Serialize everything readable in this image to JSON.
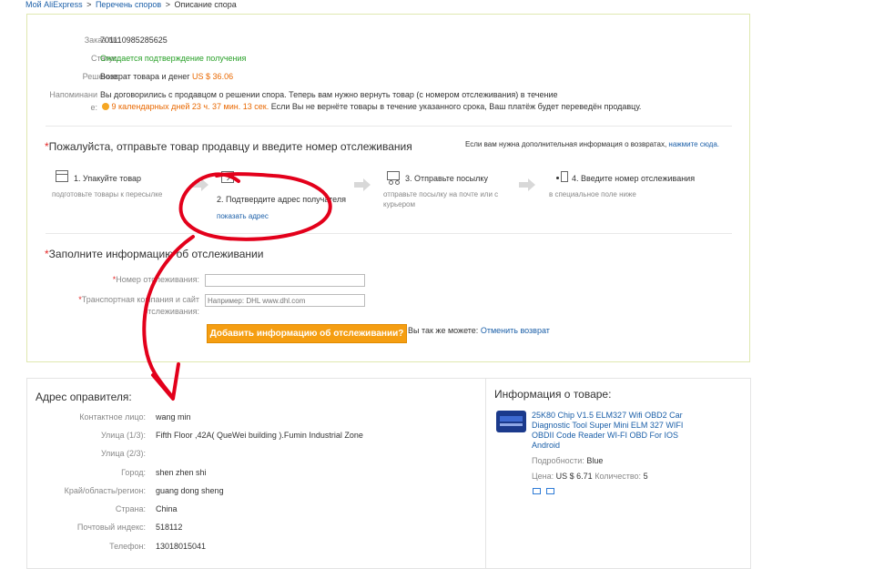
{
  "breadcrumb": {
    "home": "Мой AliExpress",
    "sep1": ">",
    "disputes": "Перечень споров",
    "sep2": ">",
    "current": "Описание спора"
  },
  "order": {
    "order_label": "Заказ №:",
    "order_no": "701110985285625",
    "status_label": "Статус:",
    "status": "Ожидается подтверждение получения",
    "decision_label": "Решение:",
    "decision": "Возврат товара и денег",
    "decision_amount": "US $ 36.06",
    "reminder_label_1": "Напоминани",
    "reminder_label_2": "е:",
    "reminder_line1": "Вы договорились с продавцом о решении спора. Теперь вам нужно вернуть товар (с номером отслеживания) в течение",
    "reminder_time": "9 календарных дней 23 ч. 37 мин. 13 сек.",
    "reminder_line2": "Если Вы не вернёте товары в течение указанного срока, Ваш платёж будет переведён продавцу."
  },
  "steps_section": {
    "title": "Пожалуйста, отправьте товар продавцу и введите номер отслеживания",
    "help_text": "Если вам нужна дополнительная информация о возвратах,",
    "help_link": "нажмите сюда.",
    "steps": [
      {
        "title": "1. Упакуйте товар",
        "desc": "подготовьте товары к пересылке"
      },
      {
        "title": "2. Подтвердите адрес получателя",
        "link": "показать адрес"
      },
      {
        "title": "3. Отправьте посылку",
        "desc": "отправьте посылку на почте или с курьером"
      },
      {
        "title": "4. Введите номер отслеживания",
        "desc": "в специальное поле ниже"
      }
    ]
  },
  "tracking_section": {
    "title": "Заполните информацию об отслеживании",
    "tracking_no_label": "Номер отслеживания:",
    "carrier_label_1": "Транспортная компания и сайт",
    "carrier_label_2": "отслеживания:",
    "carrier_placeholder": "Например: DHL www.dhl.com",
    "add_button": "Добавить информацию об отслеживании?",
    "also_text": "Вы так же можете:",
    "cancel_link": "Отменить возврат"
  },
  "sender": {
    "title": "Адрес оправителя:",
    "rows": [
      {
        "label": "Контактное лицо:",
        "value": "wang min"
      },
      {
        "label": "Улица (1/3):",
        "value": "Fifth Floor ,42A( QueWei building ).Fumin Industrial Zone"
      },
      {
        "label": "Улица (2/3):",
        "value": ""
      },
      {
        "label": "Город:",
        "value": "shen zhen shi"
      },
      {
        "label": "Край/область/регион:",
        "value": "guang dong sheng"
      },
      {
        "label": "Страна:",
        "value": "China"
      },
      {
        "label": "Почтовый индекс:",
        "value": "518112"
      },
      {
        "label": "Телефон:",
        "value": "13018015041"
      }
    ]
  },
  "product": {
    "title": "Информация о товаре:",
    "name": "25K80 Chip V1.5 ELM327 Wifi OBD2 Car Diagnostic Tool Super Mini ELM 327 WIFI OBDII Code Reader WI-FI OBD For IOS Android",
    "details_label": "Подробности:",
    "details_value": "Blue",
    "price_label": "Цена:",
    "price_value": "US $ 6.71",
    "qty_label": "Количество:",
    "qty_value": "5"
  },
  "colors": {
    "accent_orange": "#f59e12",
    "link_blue": "#1b5fa8",
    "status_green": "#2aa12a",
    "annotation_red": "#e3001b"
  }
}
